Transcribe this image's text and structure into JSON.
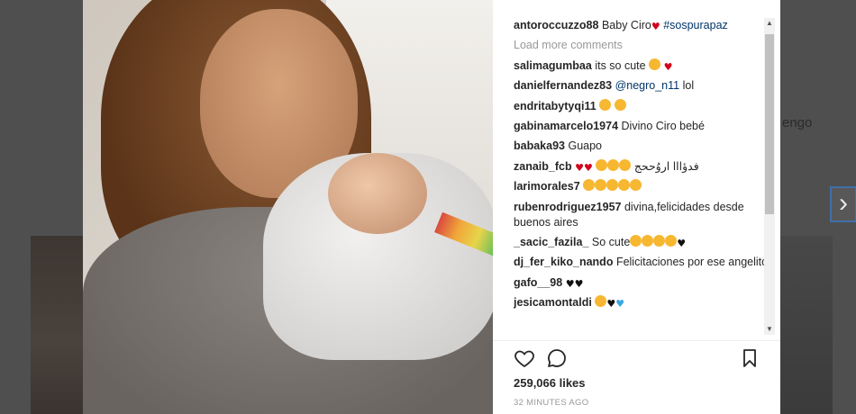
{
  "background": {
    "text": "engo"
  },
  "post": {
    "caption": {
      "user": "antoroccuzzo88",
      "text": "Baby Ciro",
      "hashtag": "#sospurapaz"
    },
    "load_more": "Load more comments",
    "comments": [
      {
        "user": "salimagumbaa",
        "text": "its so cute"
      },
      {
        "user": "danielfernandez83",
        "mention": "@negro_n11",
        "text": "lol"
      },
      {
        "user": "endritabytyqi11",
        "text": ""
      },
      {
        "user": "gabinamarcelo1974",
        "text": "Divino Ciro bebé"
      },
      {
        "user": "babaka93",
        "text": "Guapo"
      },
      {
        "user": "zanaib_fcb",
        "text": "فدؤااا اروُححج"
      },
      {
        "user": "larimorales7",
        "text": ""
      },
      {
        "user": "rubenrodriguez1957",
        "text": "divina,felicidades desde buenos aires"
      },
      {
        "user": "_sacic_fazila_",
        "text": "So cute"
      },
      {
        "user": "dj_fer_kiko_nando",
        "text": "Felicitaciones por ese angelito"
      },
      {
        "user": "gafo__98",
        "text": ""
      },
      {
        "user": "jesicamontaldi",
        "text": ""
      }
    ],
    "likes": "259,066 likes",
    "time": "32 MINUTES AGO"
  },
  "icons": {
    "like": "heart-outline-icon",
    "comment": "comment-bubble-icon",
    "save": "bookmark-icon",
    "next": "chevron-right-icon"
  },
  "colors": {
    "heart": "#d0021b",
    "link": "#003569",
    "muted": "#999999",
    "nav_border": "#3f6fa8"
  }
}
